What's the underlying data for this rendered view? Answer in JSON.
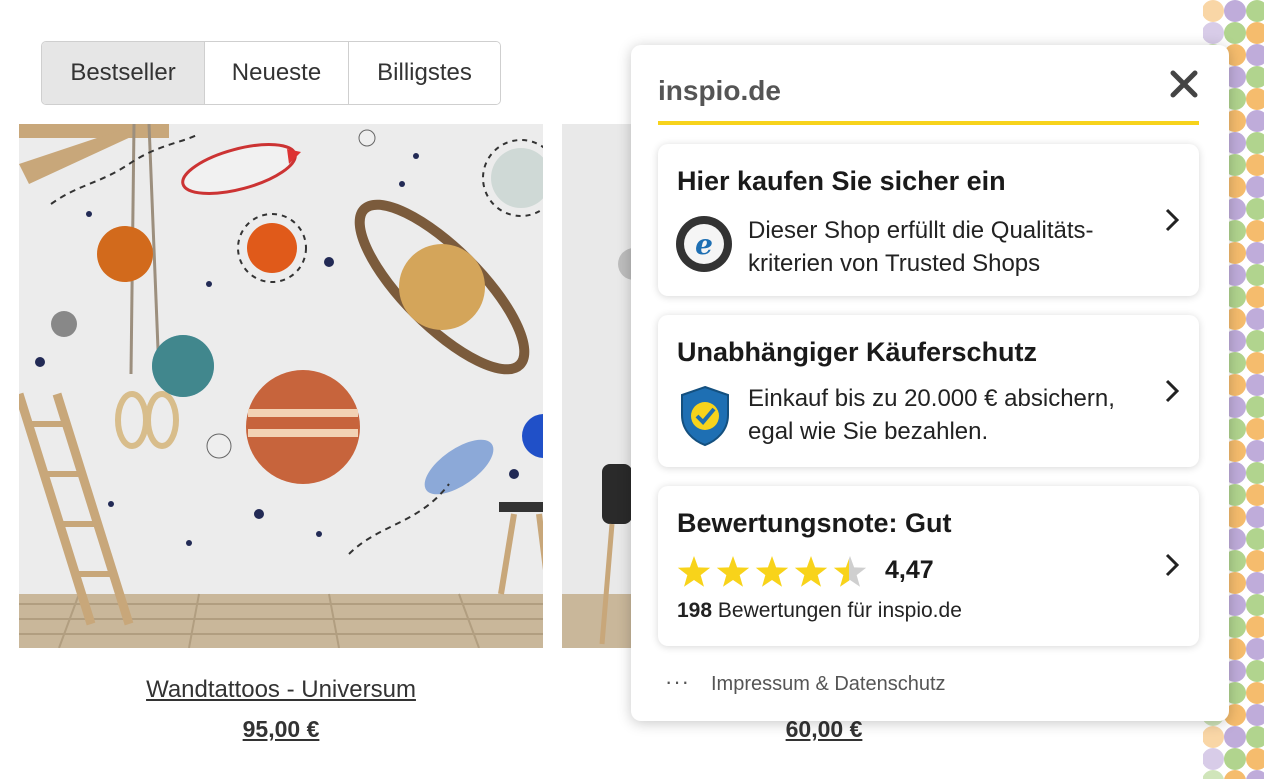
{
  "sort_tabs": [
    {
      "label": "Bestseller",
      "active": true
    },
    {
      "label": "Neueste",
      "active": false
    },
    {
      "label": "Billigstes",
      "active": false
    }
  ],
  "products": [
    {
      "title": "Wandtattoos - Universum",
      "price": "95,00 €"
    },
    {
      "title": "",
      "price": "60,00 €"
    }
  ],
  "popup": {
    "title": "inspio.de",
    "close_icon": "close-icon",
    "cards": [
      {
        "title": "Hier kaufen Sie sicher ein",
        "text_line1": "Dieser Shop erfüllt die Qualitäts-",
        "text_line2": "kriterien von Trusted Shops",
        "icon": "trusted-shops-guarantee-icon"
      },
      {
        "title": "Unabhängiger Käuferschutz",
        "text_line1": "Einkauf bis zu 20.000 € absichern,",
        "text_line2": "egal wie Sie bezahlen.",
        "icon": "shield-check-icon"
      },
      {
        "title": "Bewertungsnote: Gut",
        "rating": "4,47",
        "rating_value": 4.47,
        "rating_max": 5,
        "review_count": "198",
        "review_text": " Bewertungen für inspio.de"
      }
    ],
    "footer_dots": "···",
    "footer_link": "Impressum & Datenschutz"
  },
  "colors": {
    "accent_yellow": "#f7d31c",
    "star": "#f8d31a",
    "shield_blue": "#1e6fb3"
  }
}
